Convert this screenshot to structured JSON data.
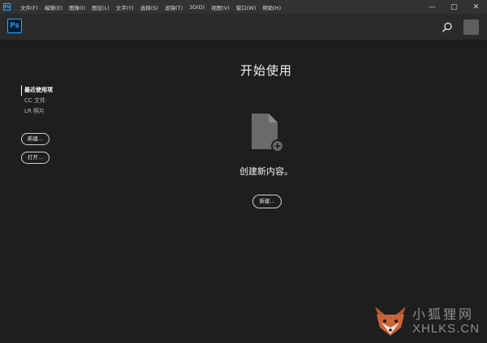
{
  "menubar": {
    "app_icon": "Ps",
    "items": [
      "文件(F)",
      "编辑(E)",
      "图像(I)",
      "图层(L)",
      "文字(Y)",
      "选择(S)",
      "滤镜(T)",
      "3D(D)",
      "视图(V)",
      "窗口(W)",
      "帮助(H)"
    ],
    "window_controls": {
      "minimize": "—",
      "maximize": "▢",
      "close": "✕"
    }
  },
  "header": {
    "logo_text": "Ps",
    "search_icon": "search-icon",
    "avatar": "avatar"
  },
  "sidebar": {
    "items": [
      "最近使用项",
      "CC 文件",
      "LR 照片"
    ],
    "active_index": 0,
    "new_button": "新建...",
    "open_button": "打开..."
  },
  "main": {
    "title": "开始使用",
    "icon": "new-document-icon",
    "create_text": "创建新内容。",
    "new_button": "新建..."
  },
  "watermark": {
    "cn": "小狐狸网",
    "en": "XHLKS.CN"
  },
  "colors": {
    "accent": "#31a8ff",
    "background": "#1e1e1e",
    "menubar": "#323232",
    "header": "#2a2a2a"
  }
}
